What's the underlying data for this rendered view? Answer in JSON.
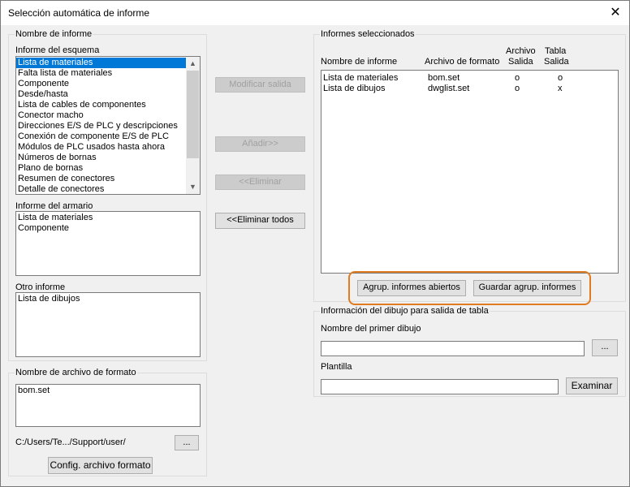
{
  "window": {
    "title": "Selección automática de informe",
    "close_glyph": "✕"
  },
  "left": {
    "group_title": "Nombre de informe",
    "schema_label": "Informe del esquema",
    "schema_items": [
      "Lista de materiales",
      "Falta lista de materiales",
      "Componente",
      "Desde/hasta",
      "Lista de cables de componentes",
      "Conector macho",
      "Direcciones E/S de PLC y descripciones",
      "Conexión de componente E/S de PLC",
      "Módulos de PLC usados hasta ahora",
      "Números de bornas",
      "Plano de bornas",
      "Resumen de conectores",
      "Detalle de conectores"
    ],
    "cabinet_label": "Informe del armario",
    "cabinet_items": [
      "Lista de materiales",
      "Componente"
    ],
    "other_label": "Otro informe",
    "other_items": [
      "Lista de dibujos"
    ]
  },
  "format": {
    "group_title": "Nombre de archivo de formato",
    "items": [
      "bom.set"
    ],
    "path": "C:/Users/Te.../Support/user/",
    "browse_label": "...",
    "config_label": "Config. archivo formato"
  },
  "middle": {
    "modify_label": "Modificar salida",
    "add_label": "Añadir>>",
    "remove_label": "<<Eliminar",
    "remove_all_label": "<<Eliminar todos"
  },
  "selected": {
    "group_title": "Informes seleccionados",
    "col_name": "Nombre de informe",
    "col_format": "Archivo de formato",
    "col_file_1": "Archivo",
    "col_file_2": "Salida",
    "col_table_1": "Tabla",
    "col_table_2": "Salida",
    "rows": [
      {
        "name": "Lista de materiales",
        "format": "bom.set",
        "file": "o",
        "table": "o"
      },
      {
        "name": "Lista de dibujos",
        "format": "dwglist.set",
        "file": "o",
        "table": "x"
      }
    ],
    "open_group_label": "Agrup. informes abiertos",
    "save_group_label": "Guardar agrup. informes",
    "highlight_color": "#e07b1f"
  },
  "drawing_info": {
    "group_title": "Información del dibujo para salida de tabla",
    "first_drawing_label": "Nombre del primer dibujo",
    "first_drawing_value": "",
    "first_browse_label": "...",
    "template_label": "Plantilla",
    "template_value": "",
    "examine_label": "Examinar"
  },
  "colors": {
    "selection": "#0078d7",
    "window_bg": "#f0f0f0"
  }
}
